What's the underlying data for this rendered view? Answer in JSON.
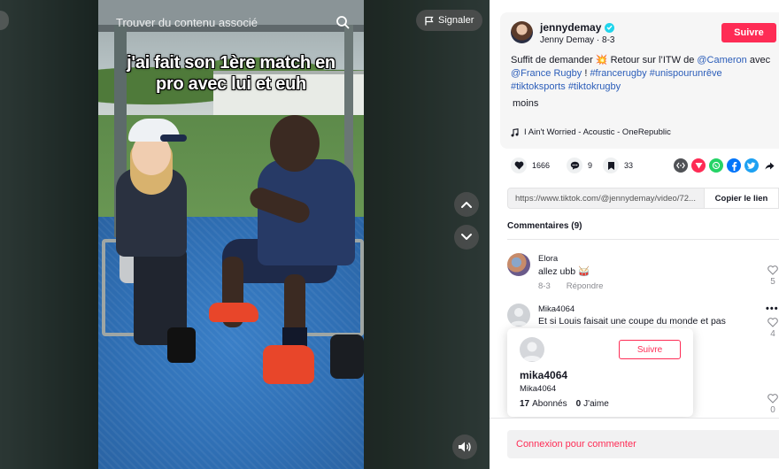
{
  "video": {
    "search_placeholder": "Trouver du contenu associé",
    "report_label": "Signaler",
    "caption": "j'ai fait son 1ère match en pro avec lui et euh"
  },
  "post": {
    "username": "jennydemay",
    "nickname": "Jenny Demay",
    "date": "8-3",
    "follow_label": "Suivre",
    "desc_prefix": "Suffit de demander ",
    "desc_emoji": "💥",
    "desc_mid": " Retour sur l’ITW de ",
    "mention1": "@Cameron",
    "desc_avec": " avec",
    "mention2": "@France Rugby",
    "desc_bang": " ! ",
    "tag1": "#francerugby",
    "tag2": "#unispourunrêve",
    "tag3": "#tiktoksports",
    "tag4": "#tiktokrugby",
    "less_label": "moins",
    "music": "I Ain't Worried - Acoustic - OneRepublic"
  },
  "stats": {
    "likes": "1666",
    "comments": "9",
    "saves": "33"
  },
  "share": {
    "icons": [
      "embed-icon",
      "send-icon",
      "whatsapp-icon",
      "facebook-icon",
      "twitter-icon",
      "share-arrow-icon"
    ],
    "colors": {
      "embed": "#505256",
      "send": "#fe2c55",
      "whatsapp": "#25d366",
      "facebook": "#0075fa",
      "twitter": "#1da1f2"
    }
  },
  "link": {
    "url": "https://www.tiktok.com/@jennydemay/video/72...",
    "copy_label": "Copier le lien"
  },
  "comments": {
    "title": "Commentaires (9)",
    "items": [
      {
        "name": "Elora",
        "text": "allez ubb 🥁",
        "date": "8-3",
        "reply": "Répondre",
        "likes": "5"
      },
      {
        "name": "Mika4064",
        "text": "Et si Louis faisait une coupe du monde et pas",
        "likes": "4"
      },
      {
        "likes": "0"
      }
    ]
  },
  "profile_popup": {
    "follow_label": "Suivre",
    "name": "mika4064",
    "nickname": "Mika4064",
    "followers": "17",
    "followers_label": "Abonnés",
    "likes": "0",
    "likes_label": "J'aime"
  },
  "login": {
    "label": "Connexion pour commenter"
  },
  "colors": {
    "accent": "#fe2c55",
    "link": "#2b5db9"
  }
}
